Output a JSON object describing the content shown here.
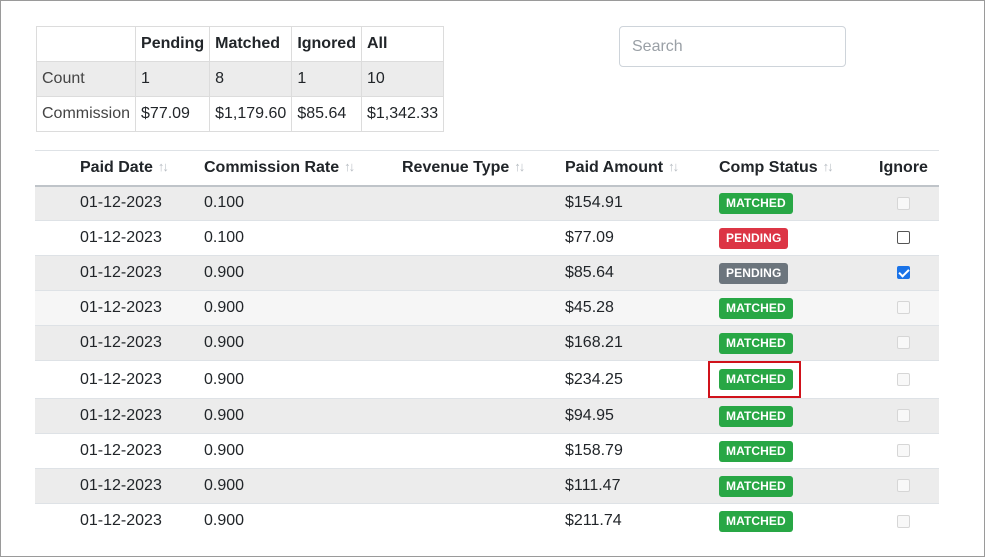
{
  "summary": {
    "headers": [
      "",
      "Pending",
      "Matched",
      "Ignored",
      "All"
    ],
    "rows": [
      {
        "label": "Count",
        "values": [
          "1",
          "8",
          "1",
          "10"
        ]
      },
      {
        "label": "Commission",
        "values": [
          "$77.09",
          "$1,179.60",
          "$85.64",
          "$1,342.33"
        ]
      }
    ]
  },
  "search": {
    "placeholder": "Search",
    "value": ""
  },
  "table": {
    "sort_icon": "↑↓",
    "columns": [
      "Paid Date",
      "Commission Rate",
      "Revenue Type",
      "Paid Amount",
      "Comp Status",
      "Ignore"
    ],
    "rows": [
      {
        "date": "01-12-2023",
        "rate": "0.100",
        "revenue_type": "",
        "amount": "$154.91",
        "status": "MATCHED",
        "status_color": "#28a745",
        "ignore": "disabled"
      },
      {
        "date": "01-12-2023",
        "rate": "0.100",
        "revenue_type": "",
        "amount": "$77.09",
        "status": "PENDING",
        "status_color": "#dc3545",
        "ignore": "unchecked"
      },
      {
        "date": "01-12-2023",
        "rate": "0.900",
        "revenue_type": "",
        "amount": "$85.64",
        "status": "PENDING",
        "status_color": "#6c757d",
        "ignore": "checked"
      },
      {
        "date": "01-12-2023",
        "rate": "0.900",
        "revenue_type": "",
        "amount": "$45.28",
        "status": "MATCHED",
        "status_color": "#28a745",
        "ignore": "disabled"
      },
      {
        "date": "01-12-2023",
        "rate": "0.900",
        "revenue_type": "",
        "amount": "$168.21",
        "status": "MATCHED",
        "status_color": "#28a745",
        "ignore": "disabled"
      },
      {
        "date": "01-12-2023",
        "rate": "0.900",
        "revenue_type": "",
        "amount": "$234.25",
        "status": "MATCHED",
        "status_color": "#28a745",
        "ignore": "disabled"
      },
      {
        "date": "01-12-2023",
        "rate": "0.900",
        "revenue_type": "",
        "amount": "$94.95",
        "status": "MATCHED",
        "status_color": "#28a745",
        "ignore": "disabled"
      },
      {
        "date": "01-12-2023",
        "rate": "0.900",
        "revenue_type": "",
        "amount": "$158.79",
        "status": "MATCHED",
        "status_color": "#28a745",
        "ignore": "disabled"
      },
      {
        "date": "01-12-2023",
        "rate": "0.900",
        "revenue_type": "",
        "amount": "$111.47",
        "status": "MATCHED",
        "status_color": "#28a745",
        "ignore": "disabled"
      },
      {
        "date": "01-12-2023",
        "rate": "0.900",
        "revenue_type": "",
        "amount": "$211.74",
        "status": "MATCHED",
        "status_color": "#28a745",
        "ignore": "disabled"
      }
    ]
  },
  "colors": {
    "matched": "#28a745",
    "pending_red": "#dc3545",
    "pending_gray": "#6c757d",
    "highlight": "#d0121b"
  }
}
